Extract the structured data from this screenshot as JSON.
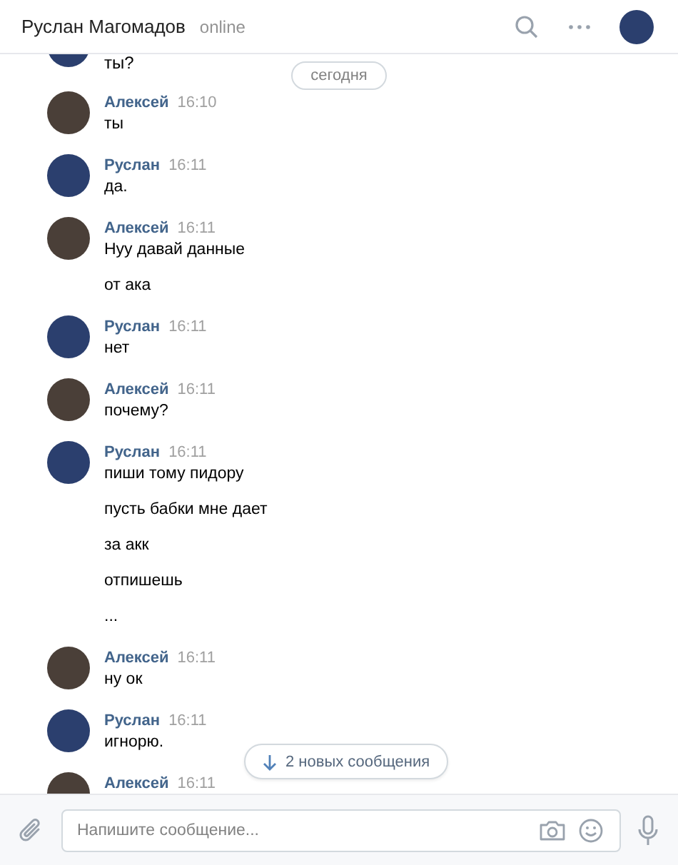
{
  "header": {
    "title": "Руслан Магомадов",
    "status": "online",
    "color": "#2b3f6e"
  },
  "cut_message": {
    "text": "ты?",
    "color": "#2b3f6e"
  },
  "date_divider": "сегодня",
  "groups": [
    {
      "author": "Алексей",
      "time": "16:10",
      "color": "#4a3f38",
      "messages": [
        "ты"
      ]
    },
    {
      "author": "Руслан",
      "time": "16:11",
      "color": "#2b3f6e",
      "messages": [
        "да."
      ]
    },
    {
      "author": "Алексей",
      "time": "16:11",
      "color": "#4a3f38",
      "messages": [
        "Нуу давай данные",
        "от ака"
      ]
    },
    {
      "author": "Руслан",
      "time": "16:11",
      "color": "#2b3f6e",
      "messages": [
        "нет"
      ]
    },
    {
      "author": "Алексей",
      "time": "16:11",
      "color": "#4a3f38",
      "messages": [
        "почему?"
      ]
    },
    {
      "author": "Руслан",
      "time": "16:11",
      "color": "#2b3f6e",
      "messages": [
        "пиши тому пидору",
        "пусть бабки мне дает",
        "за акк",
        "отпишешь",
        "..."
      ]
    },
    {
      "author": "Алексей",
      "time": "16:11",
      "color": "#4a3f38",
      "messages": [
        "ну ок"
      ]
    },
    {
      "author": "Руслан",
      "time": "16:11",
      "color": "#2b3f6e",
      "messages": [
        "игнорю."
      ]
    },
    {
      "author": "Алексей",
      "time": "16:11",
      "color": "#4a3f38"
    }
  ],
  "new_messages_button": "2 новых сообщения",
  "composer": {
    "placeholder": "Напишите сообщение..."
  }
}
